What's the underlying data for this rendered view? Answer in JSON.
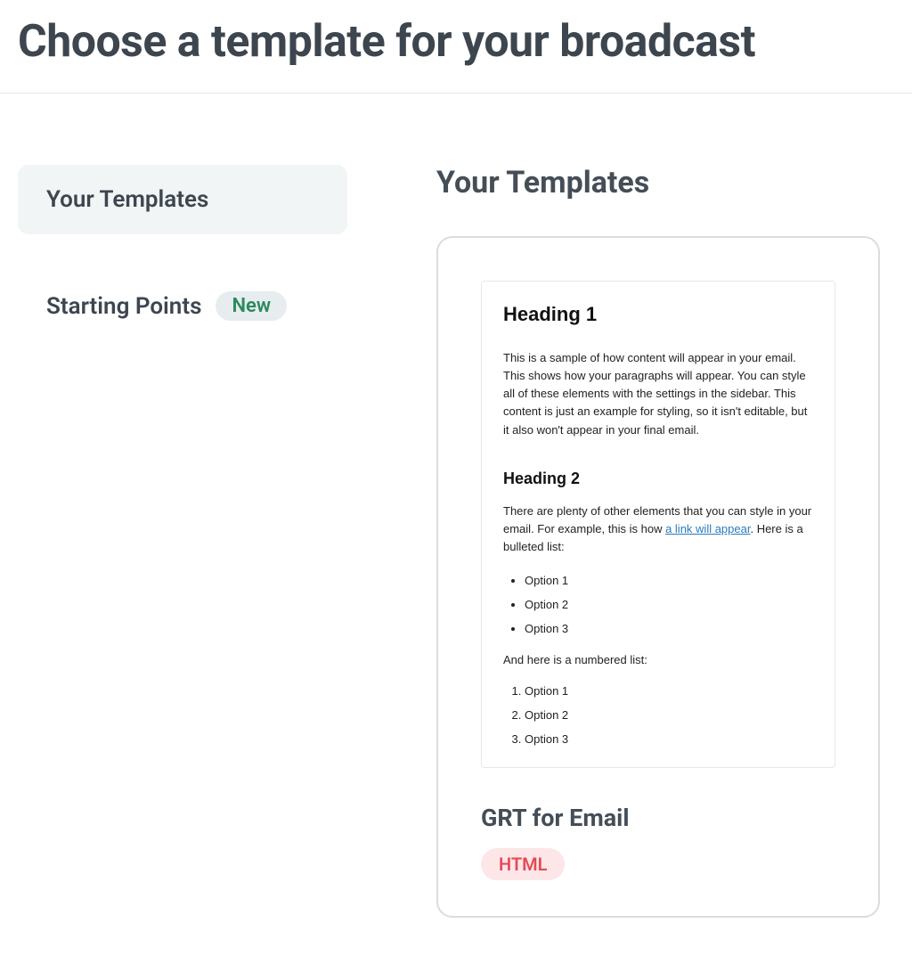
{
  "page_title": "Choose a template for your broadcast",
  "sidebar": {
    "items": [
      {
        "label": "Your Templates",
        "active": true
      },
      {
        "label": "Starting Points",
        "badge": "New",
        "active": false
      }
    ]
  },
  "main": {
    "section_title": "Your Templates",
    "templates": [
      {
        "name": "GRT for Email",
        "type_badge": "HTML",
        "preview": {
          "h1": "Heading 1",
          "p1": "This is a sample of how content will appear in your email. This shows how your paragraphs will appear. You can style all of these elements with the settings in the sidebar. This content is just an example for styling, so it isn't editable, but it also won't appear in your final email.",
          "h2": "Heading 2",
          "p2_before": "There are plenty of other elements that you can style in your email. For example, this is how ",
          "p2_link": "a link will appear",
          "p2_after": ". Here is a bulleted list:",
          "ul": [
            "Option 1",
            "Option 2",
            "Option 3"
          ],
          "p3": "And here is a numbered list:",
          "ol": [
            "Option 1",
            "Option 2",
            "Option 3"
          ]
        }
      }
    ]
  }
}
